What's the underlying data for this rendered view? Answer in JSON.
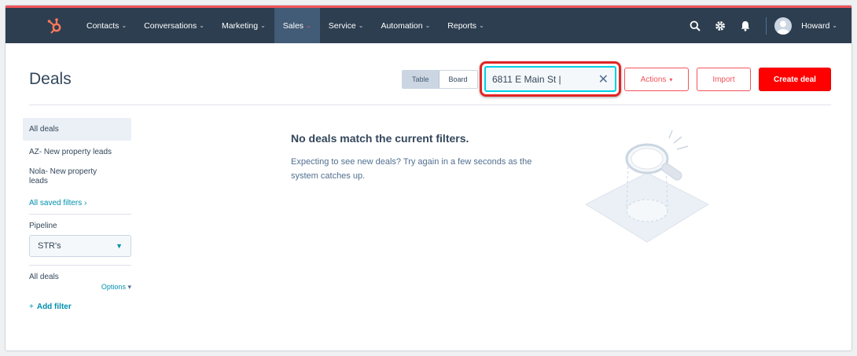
{
  "nav": {
    "items": [
      {
        "label": "Contacts",
        "active": false
      },
      {
        "label": "Conversations",
        "active": false
      },
      {
        "label": "Marketing",
        "active": false
      },
      {
        "label": "Sales",
        "active": true
      },
      {
        "label": "Service",
        "active": false
      },
      {
        "label": "Automation",
        "active": false
      },
      {
        "label": "Reports",
        "active": false
      }
    ],
    "user_name": "Howard",
    "icons": [
      "search-icon",
      "gear-icon",
      "bell-icon"
    ]
  },
  "header": {
    "title": "Deals",
    "view_toggle": {
      "table": "Table",
      "board": "Board",
      "selected": "Table"
    },
    "search": {
      "value": "6811 E Main St |",
      "placeholder": ""
    },
    "actions_label": "Actions",
    "import_label": "Import",
    "create_label": "Create deal"
  },
  "sidebar": {
    "all_deals": "All deals",
    "views": [
      "AZ- New property leads",
      "Nola- New property leads"
    ],
    "saved_filters_link": "All saved filters",
    "pipeline_label": "Pipeline",
    "pipeline_value": "STR's",
    "filter_section_label": "All deals",
    "options_label": "Options",
    "add_filter_label": "Add filter"
  },
  "empty_state": {
    "title": "No deals match the current filters.",
    "text": "Expecting to see new deals? Try again in a few seconds as the system catches up."
  },
  "colors": {
    "topbar": "#2d3e50",
    "accent": "#f2545b",
    "primary_button": "#ff0000",
    "link": "#0091ae",
    "highlight": "#e12525"
  }
}
